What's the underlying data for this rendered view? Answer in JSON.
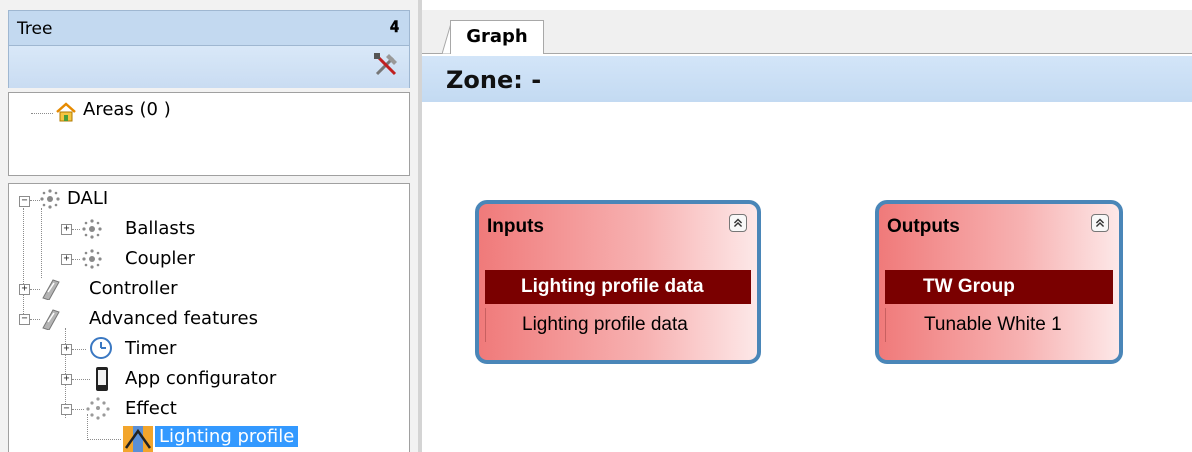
{
  "tree_panel": {
    "title": "Tree",
    "pin_icon": "pin-icon",
    "tools_icon": "tools-icon",
    "areas_label": "Areas (0 )",
    "items": [
      {
        "label": "DALI",
        "icon": "dali-network-icon"
      },
      {
        "label": "Ballasts",
        "icon": "dali-network-icon"
      },
      {
        "label": "Coupler",
        "icon": "dali-network-icon"
      },
      {
        "label": "Controller",
        "icon": "controller-icon"
      },
      {
        "label": "Advanced features",
        "icon": "controller-icon"
      },
      {
        "label": "Timer",
        "icon": "clock-icon"
      },
      {
        "label": "App configurator",
        "icon": "phone-icon"
      },
      {
        "label": "Effect",
        "icon": "effect-icon"
      },
      {
        "label": "Lighting profile",
        "icon": "lighting-profile-icon"
      }
    ],
    "selected_item": "Lighting profile"
  },
  "graph": {
    "tab_label": "Graph",
    "zone_title": "Zone: -",
    "inputs_node": {
      "title": "Inputs",
      "port_header": "Lighting profile data",
      "port_item": "Lighting profile data"
    },
    "outputs_node": {
      "title": "Outputs",
      "port_header": "TW Group",
      "port_item": "Tunable White 1"
    }
  },
  "colors": {
    "header_blue": "#c3d9f0",
    "selection_blue": "#3399ff",
    "node_border": "#4a86b8",
    "node_red": "#f07a7a",
    "port_header_dark_red": "#7a0000"
  }
}
